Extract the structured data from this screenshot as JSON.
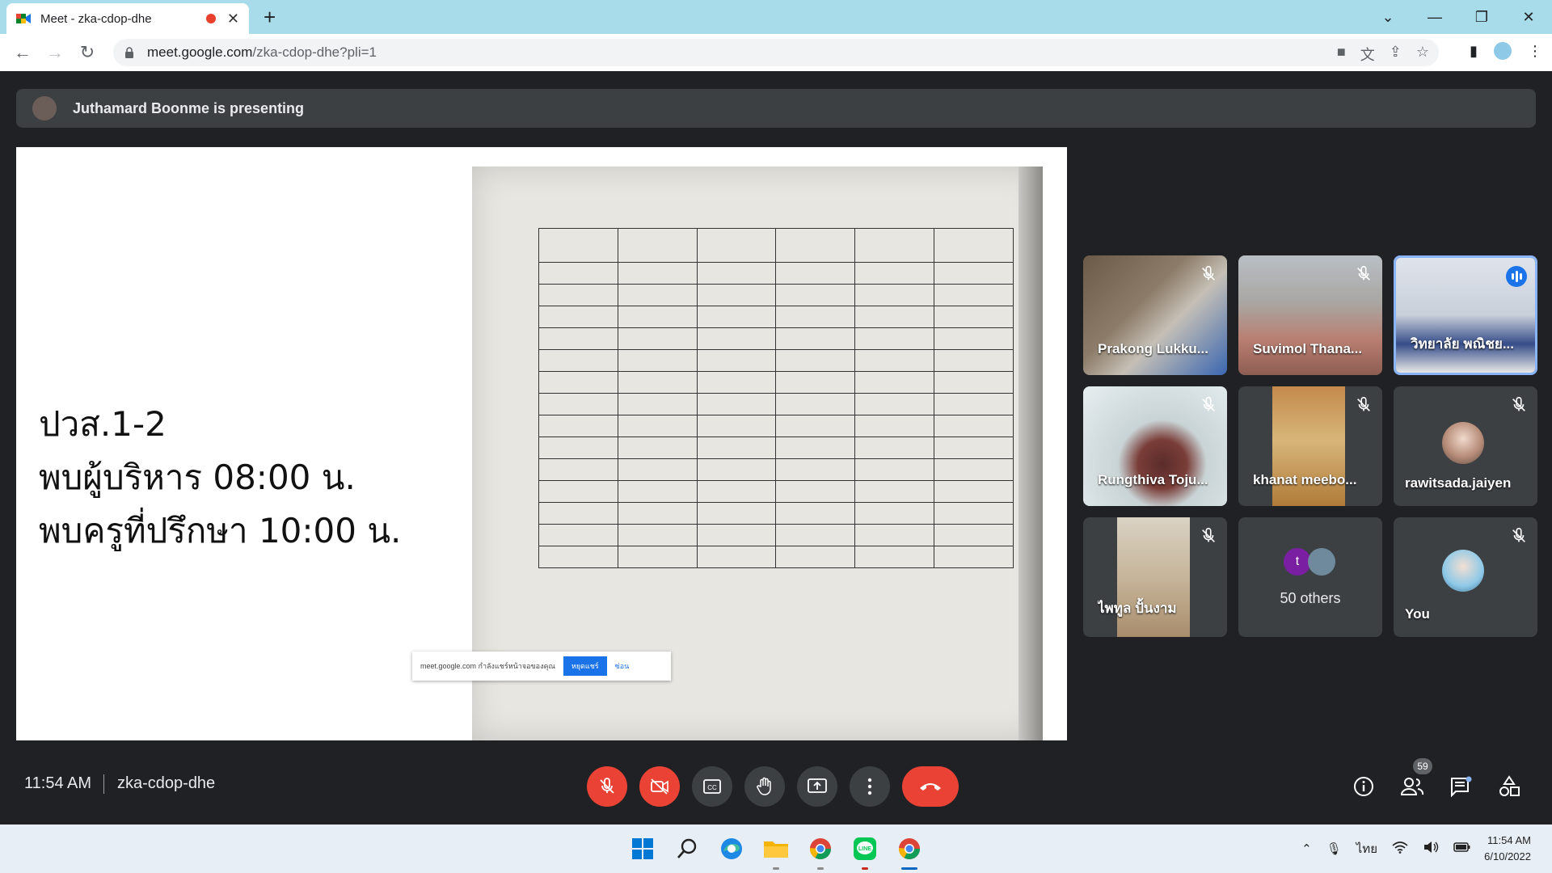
{
  "browser": {
    "tab_title": "Meet - zka-cdop-dhe",
    "url_host": "meet.google.com",
    "url_path": "/zka-cdop-dhe?pli=1"
  },
  "meet": {
    "presenting_text": "Juthamard Boonme is presenting",
    "slide_lines": [
      "ปวส.1-2",
      "พบผู้บริหาร 08:00 น.",
      "พบครูที่ปรึกษา 10:00 น."
    ],
    "share_popup": {
      "text": "meet.google.com กำลังแชร์หน้าจอของคุณ",
      "button": "หยุดแชร์",
      "link": "ซ่อน"
    },
    "participants": [
      {
        "name": "Prakong Lukku...",
        "muted": true
      },
      {
        "name": "Suvimol Thana...",
        "muted": true
      },
      {
        "name": "วิทยาลัย พณิชย...",
        "muted": false,
        "speaking": true
      },
      {
        "name": "Rungthiva Toju...",
        "muted": true
      },
      {
        "name": "khanat meebo...",
        "muted": true
      },
      {
        "name": "rawitsada.jaiyen",
        "muted": true
      },
      {
        "name": "ไพทูล ปั้นงาม",
        "muted": true
      },
      {
        "name": "50 others",
        "avatar_letter": "t"
      },
      {
        "name": "You",
        "muted": true
      }
    ],
    "time": "11:54 AM",
    "meeting_code": "zka-cdop-dhe",
    "people_count": "59"
  },
  "taskbar": {
    "lang": "ไทย",
    "time": "11:54 AM",
    "date": "6/10/2022"
  },
  "colors": {
    "meet_bg": "#202124",
    "tile_bg": "#3c4043",
    "red": "#ea4335",
    "blue": "#1a73e8",
    "tabstrip": "#a8dcea"
  }
}
